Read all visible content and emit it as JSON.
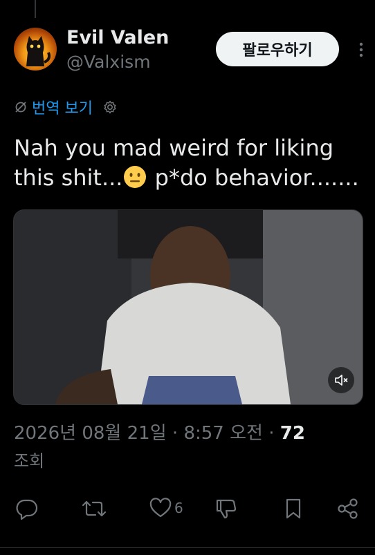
{
  "author": {
    "display_name": "Evil Valen",
    "handle": "@Valxism"
  },
  "follow_label": "팔로우하기",
  "translate_label": "번역 보기",
  "tweet": {
    "text_before_emoji": "Nah you mad weird for liking this shit...",
    "text_after_emoji": " p*do behavior.......",
    "emoji": "neutral-face"
  },
  "meta": {
    "date": "2026년 08월 21일",
    "separator": " · ",
    "time": "8:57 오전",
    "views_count": "72",
    "views_label": "조회"
  },
  "actions": {
    "reply": "",
    "retweet": "",
    "like_count": "6",
    "dislike": "",
    "bookmark": "",
    "share": ""
  },
  "colors": {
    "background": "#000000",
    "text": "#e7e9ea",
    "secondary": "#71767b",
    "link": "#1d9bf0",
    "follow_bg": "#eff3f4"
  }
}
